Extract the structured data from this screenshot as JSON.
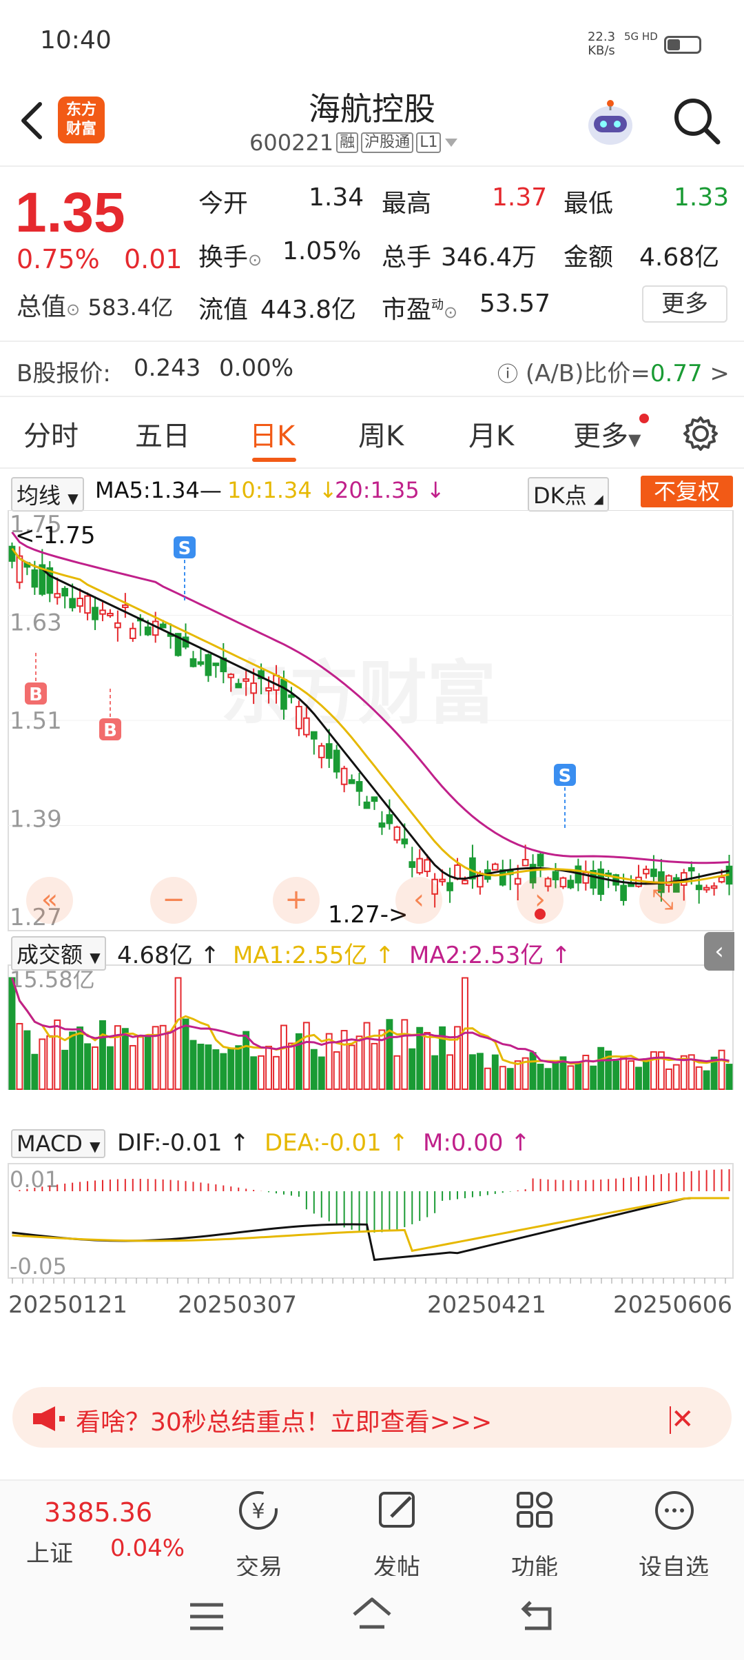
{
  "status": {
    "time": "10:40",
    "speed": "22.3",
    "speed_unit": "KB/s",
    "network": "5G HD"
  },
  "header": {
    "logo_line1": "东方",
    "logo_line2": "财富",
    "stock_name": "海航控股",
    "code": "600221",
    "tags": [
      "融",
      "沪股通",
      "L1"
    ]
  },
  "quote": {
    "price": "1.35",
    "pct": "0.75%",
    "change": "0.01",
    "mktcap_label": "总值",
    "mktcap_value": "583.4亿",
    "open_label": "今开",
    "open_value": "1.34",
    "high_label": "最高",
    "high_value": "1.37",
    "low_label": "最低",
    "low_value": "1.33",
    "turnover_label": "换手",
    "turnover_value": "1.05%",
    "volume_label": "总手",
    "volume_value": "346.4万",
    "amount_label": "金额",
    "amount_value": "4.68亿",
    "float_label": "流值",
    "float_value": "443.8亿",
    "pe_label": "市盈",
    "pe_sup": "动",
    "pe_value": "53.57",
    "more_label": "更多"
  },
  "bshare": {
    "label": "B股报价:",
    "price": "0.243",
    "pct": "0.00%",
    "ratio_label": "(A/B)比价=",
    "ratio_value": "0.77"
  },
  "tabs": [
    "分时",
    "五日",
    "日K",
    "周K",
    "月K",
    "更多"
  ],
  "active_tab": "日K",
  "ma": {
    "selector": "均线",
    "ma5": "MA5:1.34—",
    "ma10": "10:1.34 ↓",
    "ma20": "20:1.35 ↓",
    "dk": "DK点",
    "fq": "不复权"
  },
  "colors": {
    "up": "#e5292e",
    "down": "#1a9b34",
    "accent": "#f25a16",
    "ma5": "#111111",
    "ma10": "#e6b800",
    "ma20": "#c0208a"
  },
  "chart_data": [
    {
      "type": "candlestick",
      "y_ticks": [
        "1.75",
        "1.63",
        "1.51",
        "1.39",
        "1.27"
      ],
      "ylim": [
        1.27,
        1.75
      ],
      "annotations": {
        "high": "<-1.75",
        "low": "1.27->"
      },
      "markers": [
        "S",
        "B",
        "B",
        "S"
      ],
      "ma_labels": [
        "MA5",
        "10",
        "20"
      ]
    },
    {
      "type": "bar",
      "title": "成交额",
      "value": "4.68亿 ↑",
      "ma1": "MA1:2.55亿 ↑",
      "ma2": "MA2:2.53亿 ↑",
      "y_max_label": "15.58亿"
    },
    {
      "type": "line",
      "title": "MACD",
      "dif": "DIF:-0.01 ↑",
      "dea": "DEA:-0.01 ↑",
      "m": "M:0.00 ↑",
      "y_ticks": [
        "0.01",
        "-0.05"
      ],
      "x_ticks": [
        "20250121",
        "20250307",
        "20250421",
        "20250606"
      ]
    }
  ],
  "banner": {
    "text": "看啥？30秒总结重点！立即查看>>>"
  },
  "bottom_nav": {
    "index_value": "3385.36",
    "index_name": "上证",
    "index_pct": "0.04%",
    "items": [
      "交易",
      "发帖",
      "功能",
      "设自选"
    ]
  }
}
